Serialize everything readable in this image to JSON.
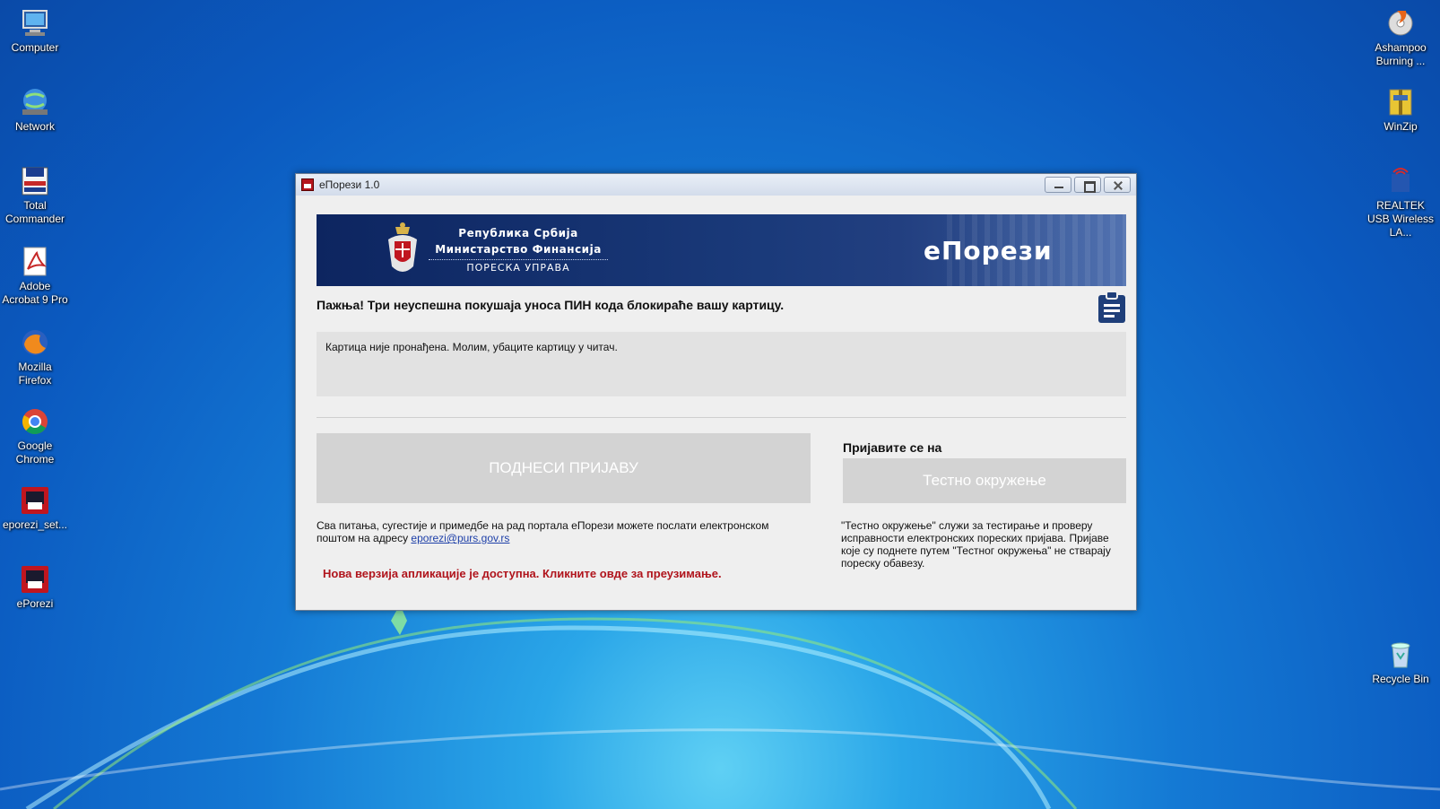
{
  "desktop": {
    "left_icons": [
      {
        "label": "Computer",
        "icon": "computer-icon"
      },
      {
        "label": "Network",
        "icon": "network-icon"
      },
      {
        "label": "Total Commander",
        "icon": "total-commander-icon"
      },
      {
        "label": "Adobe Acrobat 9 Pro",
        "icon": "acrobat-icon"
      },
      {
        "label": "Mozilla Firefox",
        "icon": "firefox-icon"
      },
      {
        "label": "Google Chrome",
        "icon": "chrome-icon"
      },
      {
        "label": "eporezi_set...",
        "icon": "eporezi-setup-icon"
      },
      {
        "label": "ePorezi",
        "icon": "eporezi-icon"
      }
    ],
    "right_icons": [
      {
        "label": "Ashampoo Burning ...",
        "icon": "ashampoo-icon"
      },
      {
        "label": "WinZip",
        "icon": "winzip-icon"
      },
      {
        "label": "REALTEK USB Wireless LA...",
        "icon": "realtek-icon"
      },
      {
        "label": "Recycle Bin",
        "icon": "recycle-bin-icon"
      }
    ]
  },
  "window": {
    "title": "еПорези 1.0",
    "banner": {
      "line1": "Република Србија",
      "line2": "Министарство Финансија",
      "line3": "ПОРЕСКА УПРАВА",
      "brand": "еПорези"
    },
    "warning": "Пажња! Три неуспешна покушаја уноса ПИН кода блокираће вашу картицу.",
    "message": "Картица није пронађена. Молим, убаците картицу у читач.",
    "submit_button": "ПОДНЕСИ ПРИЈАВУ",
    "login_label": "Пријавите се на",
    "test_button": "Тестно окружење",
    "info_text": "Сва питања, сугестије и примедбе на рад портала еПорези можете послати електронском поштом на адресу",
    "email": "eporezi@purs.gov.rs",
    "test_info": "\"Тестно окружење\" служи за тестирање и проверу исправности електронских пореских пријава. Пријаве које су поднете путем \"Тестног окружења\" не стварају пореску обавезу.",
    "update_link": "Нова верзија апликације је доступна. Кликните овде за преузимање.",
    "colors": {
      "banner": "#0d2560",
      "update": "#b0141c",
      "button": "#d3d3d3"
    }
  }
}
